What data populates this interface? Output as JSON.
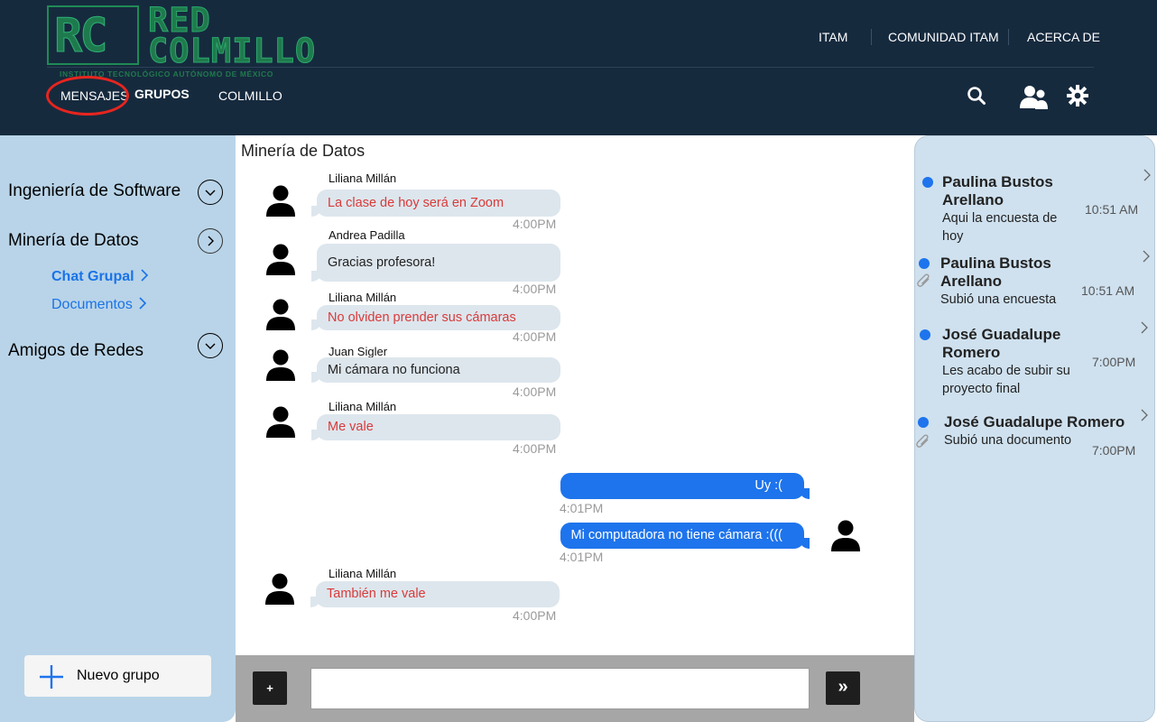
{
  "header": {
    "logo": {
      "mark": "RC",
      "name_line1": "RED",
      "name_line2": "COLMILLO",
      "subtitle": "INSTITUTO TECNOLÓGICO AUTÓNOMO DE MÉXICO"
    },
    "top_nav": [
      "ITAM",
      "COMUNIDAD ITAM",
      "ACERCA DE"
    ],
    "sub_nav": [
      "MENSAJES",
      "GRUPOS",
      "COLMILLO"
    ],
    "icons": [
      "search-icon",
      "users-icon",
      "gear-icon"
    ],
    "highlight_color": "#e6251f"
  },
  "sidebar": {
    "sections": [
      {
        "label": "Ingeniería de Software",
        "toggle": "chevron-down-icon"
      },
      {
        "label": "Minería de Datos",
        "toggle": "chevron-right-icon",
        "children": [
          "Chat Grupal",
          "Documentos"
        ]
      },
      {
        "label": "Amigos de Redes",
        "toggle": "chevron-down-icon"
      }
    ],
    "new_group_label": "Nuevo grupo"
  },
  "chat": {
    "title": "Minería de Datos",
    "messages": [
      {
        "sender": "Liliana Millán",
        "text": "La clase de hoy será en Zoom",
        "time": "4:00PM",
        "outgoing": false
      },
      {
        "sender": "Andrea Padilla",
        "text": "Gracias profesora!",
        "time": "4:00PM",
        "outgoing": false
      },
      {
        "sender": "Liliana Millán",
        "text": "No olviden prender sus cámaras",
        "time": "4:00PM",
        "outgoing": false
      },
      {
        "sender": "Juan Sigler",
        "text": "Mi cámara no funciona",
        "time": "4:00PM",
        "outgoing": false
      },
      {
        "sender": "Liliana Millán",
        "text": "Me vale",
        "time": "4:00PM",
        "outgoing": false
      },
      {
        "sender": "",
        "text": "Uy :(",
        "time": "4:01PM",
        "outgoing": true
      },
      {
        "sender": "",
        "text": "Mi computadora no tiene cámara :(((",
        "time": "4:01PM",
        "outgoing": true
      },
      {
        "sender": "Liliana Millán",
        "text": "También me vale",
        "time": "4:00PM",
        "outgoing": false
      }
    ],
    "input": {
      "value": "",
      "placeholder": ""
    },
    "attach_label": "+",
    "send_label": "»"
  },
  "notifications": [
    {
      "name": "Paulina Bustos Arellano",
      "text": "Aqui la encuesta de hoy",
      "time": "10:51 AM",
      "attachment": false
    },
    {
      "name": "Paulina Bustos Arellano",
      "text": "Subió una encuesta",
      "time": "10:51 AM",
      "attachment": true
    },
    {
      "name": "José Guadalupe Romero",
      "text": "Les acabo de subir su proyecto final",
      "time": "7:00PM",
      "attachment": false
    },
    {
      "name": "José Guadalupe Romero",
      "text": "Subió una documento",
      "time": "7:00PM",
      "attachment": true
    }
  ],
  "colors": {
    "header_bg": "#162a3e",
    "sidebar_bg": "#b9d4e8",
    "panel_bg": "#cfe1ef",
    "accent": "#1e74ec",
    "incoming_bubble": "#dde6ed",
    "teacher_text": "#d93a3a"
  }
}
